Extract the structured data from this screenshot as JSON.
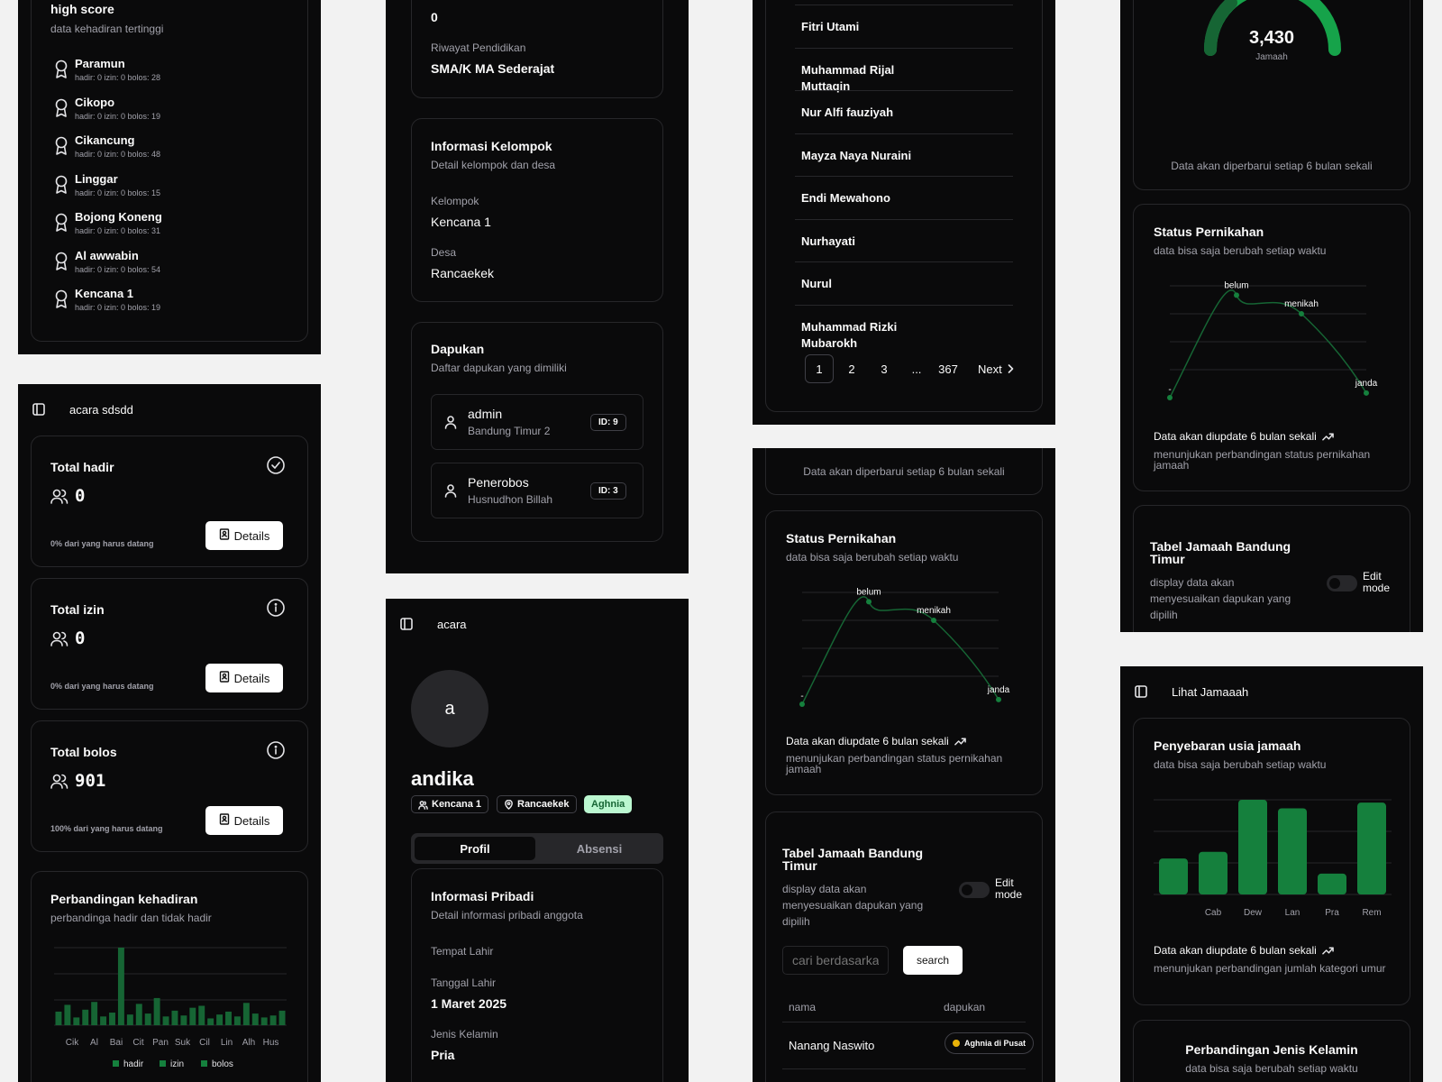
{
  "highscore": {
    "title": "high score",
    "subtitle": "data kehadiran tertinggi",
    "items": [
      {
        "name": "Paramun",
        "stats": "hadir: 0 izin: 0 bolos: 28"
      },
      {
        "name": "Cikopo",
        "stats": "hadir: 0 izin: 0 bolos: 19"
      },
      {
        "name": "Cikancung",
        "stats": "hadir: 0 izin: 0 bolos: 48"
      },
      {
        "name": "Linggar",
        "stats": "hadir: 0 izin: 0 bolos: 15"
      },
      {
        "name": "Bojong Koneng",
        "stats": "hadir: 0 izin: 0 bolos: 31"
      },
      {
        "name": "Al awwabin",
        "stats": "hadir: 0 izin: 0 bolos: 54"
      },
      {
        "name": "Kencana 1",
        "stats": "hadir: 0 izin: 0 bolos: 19"
      }
    ]
  },
  "acara_panel": {
    "header": "acara sdsdd",
    "stats": [
      {
        "title": "Total hadir",
        "value": "0",
        "note": "0% dari yang harus datang",
        "button": "Details",
        "icon": "check-circle-icon"
      },
      {
        "title": "Total izin",
        "value": "0",
        "note": "0% dari yang harus datang",
        "button": "Details",
        "icon": "info-circle-icon"
      },
      {
        "title": "Total bolos",
        "value": "901",
        "note": "100% dari yang harus datang",
        "button": "Details",
        "icon": "info-circle-icon"
      }
    ],
    "compare": {
      "title": "Perbandingan kehadiran",
      "subtitle": "perbandinga hadir dan tidak hadir"
    }
  },
  "chart_data": [
    {
      "type": "bar",
      "title": "Perbandingan kehadiran",
      "categories": [
        "Cik",
        "Al",
        "Bai",
        "Cit",
        "Pan",
        "Suk",
        "Cil",
        "Lin",
        "Alh",
        "Hus"
      ],
      "series": [
        {
          "name": "hadir",
          "values": [
            0,
            0,
            0,
            0,
            0,
            0,
            0,
            0,
            0,
            0
          ]
        },
        {
          "name": "izin",
          "values": [
            0,
            0,
            0,
            0,
            0,
            0,
            0,
            0,
            0,
            0
          ]
        },
        {
          "name": "bolos",
          "values": [
            19,
            28,
            14,
            54,
            19,
            31,
            16,
            15,
            16,
            19
          ]
        }
      ],
      "legend": [
        "hadir",
        "izin",
        "bolos"
      ],
      "legend_position": "bottom"
    },
    {
      "type": "line",
      "title": "Status Pernikahan",
      "categories": [
        "-",
        "belum",
        "menikah",
        "janda"
      ],
      "values": [
        0,
        110,
        90,
        5
      ]
    },
    {
      "type": "bar",
      "title": "Penyebaran usia jamaah",
      "categories": [
        "",
        "Cab",
        "Dew",
        "Lan",
        "Pra",
        "Rem"
      ],
      "values": [
        38,
        45,
        100,
        91,
        22,
        97
      ]
    }
  ],
  "profile_top": {
    "partial_value": "0",
    "riwayat_label": "Riwayat Pendidikan",
    "riwayat_value": "SMA/K MA Sederajat",
    "kelompok_card": {
      "title": "Informasi Kelompok",
      "subtitle": "Detail kelompok dan desa",
      "kelompok_label": "Kelompok",
      "kelompok_value": "Kencana 1",
      "desa_label": "Desa",
      "desa_value": "Rancaekek"
    },
    "dapukan_card": {
      "title": "Dapukan",
      "subtitle": "Daftar dapukan yang dimiliki",
      "items": [
        {
          "name": "admin",
          "place": "Bandung Timur 2",
          "id": "ID: 9"
        },
        {
          "name": "Penerobos",
          "place": "Husnudhon Billah",
          "id": "ID: 3"
        }
      ]
    }
  },
  "profile_bottom": {
    "header": "acara",
    "avatar_letter": "a",
    "name": "andika",
    "badges": [
      "Kencana 1",
      "Rancaekek",
      "Aghnia"
    ],
    "tabs": [
      "Profil",
      "Absensi"
    ],
    "card_title": "Informasi Pribadi",
    "card_subtitle": "Detail informasi pribadi anggota",
    "fields": [
      {
        "label": "Tempat Lahir",
        "value": ""
      },
      {
        "label": "Tanggal Lahir",
        "value": "1 Maret 2025"
      },
      {
        "label": "Jenis Kelamin",
        "value": "Pria"
      }
    ]
  },
  "name_list": {
    "names": [
      "Fitri Utami",
      "Muhammad Rijal Muttaqin",
      "Nur Alfi fauziyah",
      "Mayza Naya Nuraini",
      "Endi Mewahono",
      "Nurhayati",
      "Nurul",
      "Muhammad Rizki Mubarokh"
    ],
    "pagination": [
      "1",
      "2",
      "3",
      "...",
      "367"
    ],
    "next_label": "Next"
  },
  "status_panel": {
    "update_note": "Data akan diperbarui setiap 6 bulan sekali",
    "status": {
      "title": "Status Pernikahan",
      "subtitle": "data bisa saja berubah setiap waktu",
      "labels": [
        "belum",
        "menikah",
        "janda",
        "-"
      ],
      "footer": "Data akan diupdate 6 bulan sekali",
      "footer_sub": "menunjukan perbandingan status pernikahan jamaah"
    },
    "table": {
      "title": "Tabel Jamaah Bandung Timur",
      "subtitle": "display data akan menyesuaikan dapukan yang dipilih",
      "edit_mode": "Edit mode",
      "search_placeholder": "cari berdasarkan",
      "search_button": "search",
      "col_nama": "nama",
      "col_dapukan": "dapukan",
      "row_name": "Nanang Naswito",
      "row_dapukan": "Aghnia di Pusat"
    }
  },
  "gauge_panel": {
    "value": "3,430",
    "unit": "Jamaah",
    "update_note": "Data akan diperbarui setiap 6 bulan sekali",
    "status": {
      "title": "Status Pernikahan",
      "subtitle": "data bisa saja berubah setiap waktu",
      "labels": [
        "belum",
        "menikah",
        "janda",
        "-"
      ],
      "footer": "Data akan diupdate 6 bulan sekali",
      "footer_sub": "menunjukan perbandingan status pernikahan jamaah"
    },
    "table": {
      "title": "Tabel Jamaah Bandung Timur",
      "subtitle": "display data akan menyesuaikan dapukan yang dipilih",
      "edit_mode": "Edit mode"
    }
  },
  "jamaah_panel": {
    "header": "Lihat Jamaaah",
    "usia": {
      "title": "Penyebaran usia jamaah",
      "subtitle": "data bisa saja berubah setiap waktu",
      "footer": "Data akan diupdate 6 bulan sekali",
      "footer_sub": "menunjukan perbandingan jumlah kategori umur"
    },
    "gender": {
      "title": "Perbandingan Jenis Kelamin",
      "subtitle": "data bisa saja berubah setiap waktu"
    }
  },
  "colors": {
    "bg": "#0a0a0b",
    "page": "#f2f2f2",
    "green": "#16a34a",
    "green_dark": "#15803d",
    "border": "#27272a",
    "aghnia_bg": "#bbf7d0",
    "gold": "#eab308"
  }
}
